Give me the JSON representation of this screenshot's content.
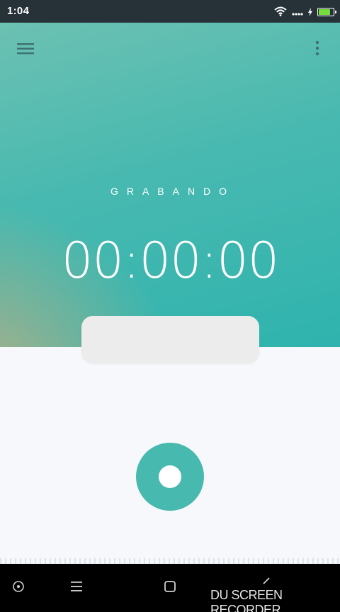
{
  "status_bar": {
    "time": "1:04",
    "icons": [
      "wifi-icon",
      "signal-dots-icon",
      "charging-icon",
      "battery-icon"
    ],
    "battery_level": 0.85
  },
  "header": {
    "menu_icon": "hamburger-menu-icon",
    "overflow_icon": "more-vert-icon"
  },
  "recorder": {
    "state_label": "GRABANDO",
    "elapsed": "00:00:00"
  },
  "record_button": {
    "icon": "record-icon"
  },
  "nav_bar": {
    "buttons": [
      "assistant-icon",
      "menu-icon",
      "home-square-icon",
      "back-icon"
    ]
  },
  "watermark": "DU SCREEN RECORDER",
  "colors": {
    "accent": "#47b9ae",
    "gradient_start": "#6cc1b2",
    "gradient_end": "#2fb3ae",
    "status_bar": "#263238",
    "battery_fill": "#76dd3a",
    "body_bg": "#f6f8fb"
  }
}
